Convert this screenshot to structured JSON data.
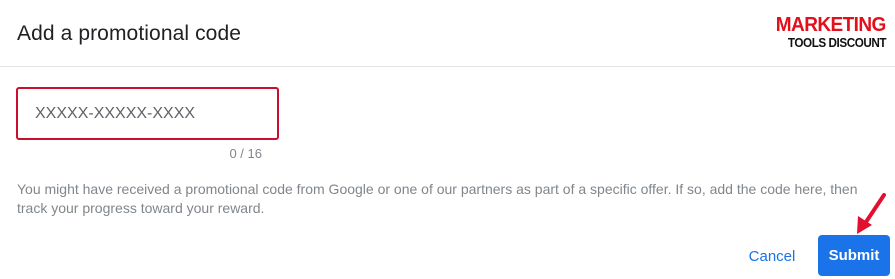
{
  "dialog": {
    "title": "Add a promotional code"
  },
  "logo": {
    "line1": "MARKETING",
    "line2": "TOOLS DISCOUNT"
  },
  "code_field": {
    "value": "",
    "placeholder": "XXXXX-XXXXX-XXXX",
    "counter": "0 / 16"
  },
  "info_text": "You might have received a promotional code from Google or one of our partners as part of a specific offer. If so, add the code here, then track your progress toward your reward.",
  "actions": {
    "cancel_label": "Cancel",
    "submit_label": "Submit"
  },
  "colors": {
    "accent": "#1a73e8",
    "input_border": "#c8102e",
    "logo_red": "#e1101a",
    "arrow": "#e0102e"
  },
  "icons": {
    "annotation": "red-arrow-icon"
  }
}
